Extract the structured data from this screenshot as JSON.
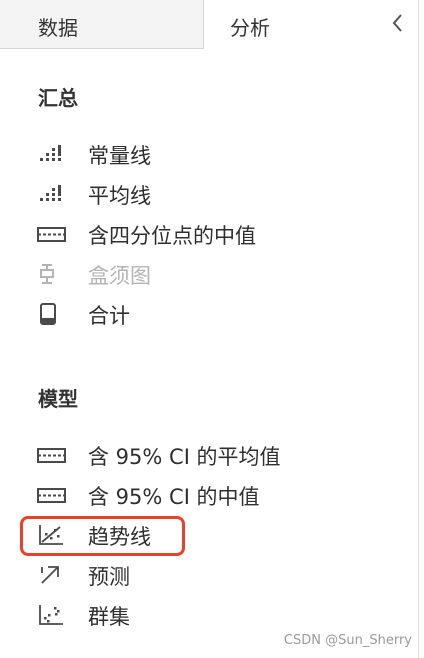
{
  "tabs": {
    "data_label": "数据",
    "analysis_label": "分析"
  },
  "summary": {
    "title": "汇总",
    "items": [
      {
        "label": "常量线",
        "icon": "bar-dots-icon"
      },
      {
        "label": "平均线",
        "icon": "bar-dots-icon"
      },
      {
        "label": "含四分位点的中值",
        "icon": "band-line-icon"
      },
      {
        "label": "盒须图",
        "icon": "box-plot-icon",
        "disabled": true
      },
      {
        "label": "合计",
        "icon": "totals-icon"
      }
    ]
  },
  "model": {
    "title": "模型",
    "items": [
      {
        "label": "含 95% CI 的平均值",
        "icon": "band-line-icon"
      },
      {
        "label": "含 95% CI 的中值",
        "icon": "band-line-icon"
      },
      {
        "label": "趋势线",
        "icon": "trend-scatter-icon",
        "highlighted": true
      },
      {
        "label": "预测",
        "icon": "forecast-arrow-icon"
      },
      {
        "label": "群集",
        "icon": "cluster-scatter-icon"
      }
    ]
  },
  "watermark": "CSDN @Sun_Sherry",
  "colors": {
    "highlight": "#e8412c",
    "icon": "#4a4a4a",
    "disabled": "#b4b4b4"
  }
}
